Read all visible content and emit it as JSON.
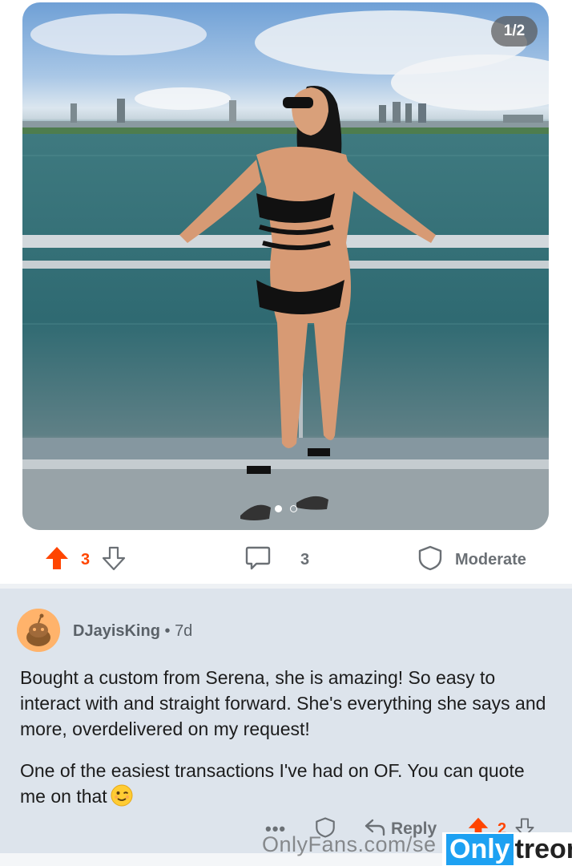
{
  "media": {
    "counter": "1/2",
    "dots": [
      true,
      false
    ]
  },
  "post_actions": {
    "upvotes": "3",
    "comments": "3",
    "moderate_label": "Moderate"
  },
  "comment": {
    "author": "DJayisKing",
    "age": "7d",
    "paragraphs": [
      "Bought a custom from Serena, she is amazing! So easy to interact with and straight forward. She's everything she says and more, overdelivered on my request!",
      "One of the easiest transactions I've had on OF. You can quote me on that"
    ],
    "emoji": "winking-face",
    "more_label": "•••",
    "reply_label": "Reply",
    "votes": "2"
  },
  "watermark": {
    "url": "OnlyFans.com/se",
    "brand_only": "Only",
    "brand_treon": "treon"
  },
  "colors": {
    "upvote": "#ff4500",
    "comment_bg": "#dde4ec",
    "muted": "#6b7075"
  }
}
